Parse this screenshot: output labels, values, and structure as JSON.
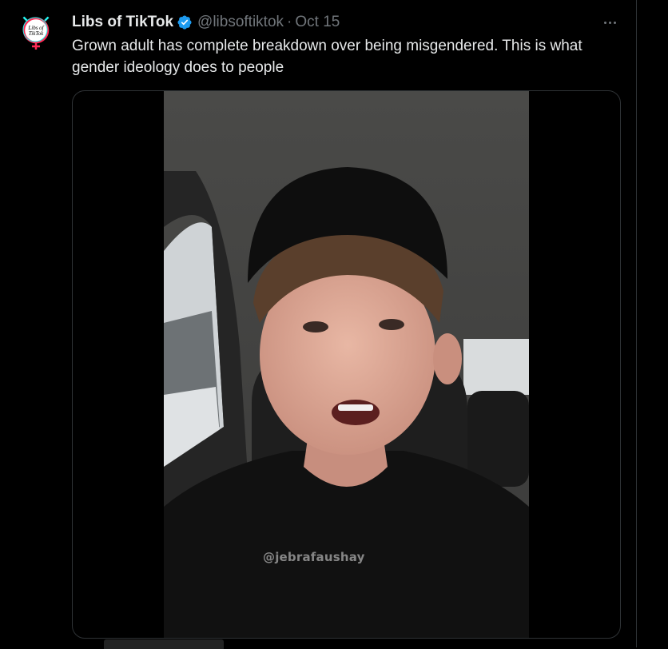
{
  "tweet": {
    "display_name": "Libs of TikTok",
    "handle": "@libsoftiktok",
    "separator": "·",
    "timestamp": "Oct 15",
    "text": "Grown adult has complete breakdown over being misgendered. This is what gender ideology does to people",
    "verified": true,
    "verified_color": "#1d9bf0",
    "more_icon": "more-horizontal-icon",
    "avatar_text_line1": "Libs of",
    "avatar_text_line2": "TikTok"
  },
  "media": {
    "type": "video",
    "watermark": "@jebrafaushay"
  },
  "colors": {
    "background": "#000000",
    "text_primary": "#e7e9ea",
    "text_secondary": "#71767b",
    "border": "#2f3336"
  }
}
